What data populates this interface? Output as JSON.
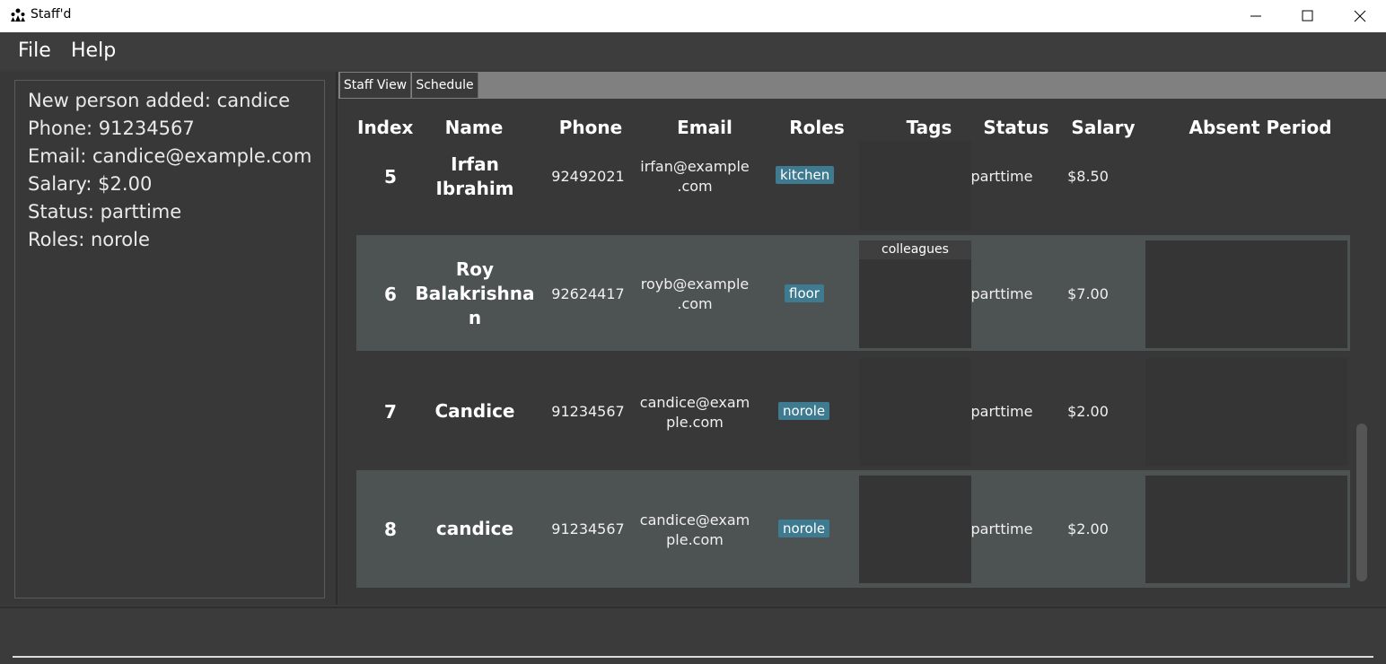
{
  "window": {
    "title": "Staff'd"
  },
  "menu": {
    "file": "File",
    "help": "Help"
  },
  "result": {
    "lines": [
      "New person added: candice",
      "Phone: 91234567",
      "Email: candice@example.com",
      "Salary: $2.00",
      "Status: parttime",
      "Roles: norole"
    ]
  },
  "tabs": {
    "staff_view": "Staff View",
    "schedule": "Schedule"
  },
  "table": {
    "headers": {
      "index": "Index",
      "name": "Name",
      "phone": "Phone",
      "email": "Email",
      "roles": "Roles",
      "tags": "Tags",
      "status": "Status",
      "salary": "Salary",
      "absent": "Absent Period"
    },
    "rows": [
      {
        "index": "5",
        "name_lines": [
          "Irfan",
          "Ibrahim"
        ],
        "phone": "92492021",
        "email_lines": [
          "irfan@example",
          ".com"
        ],
        "role": "kitchen",
        "tags": [],
        "status": "parttime",
        "salary": "$8.50"
      },
      {
        "index": "6",
        "name_lines": [
          "Roy",
          "Balakrishna",
          "n"
        ],
        "phone": "92624417",
        "email_lines": [
          "royb@example",
          ".com"
        ],
        "role": "floor",
        "tags": [
          "colleagues"
        ],
        "status": "parttime",
        "salary": "$7.00"
      },
      {
        "index": "7",
        "name_lines": [
          "Candice"
        ],
        "phone": "91234567",
        "email_lines": [
          "candice@exam",
          "ple.com"
        ],
        "role": "norole",
        "tags": [],
        "status": "parttime",
        "salary": "$2.00"
      },
      {
        "index": "8",
        "name_lines": [
          "candice"
        ],
        "phone": "91234567",
        "email_lines": [
          "candice@exam",
          "ple.com"
        ],
        "role": "norole",
        "tags": [],
        "status": "parttime",
        "salary": "$2.00"
      }
    ]
  },
  "colors": {
    "row_dark": "#383838",
    "row_light": "#4d5253",
    "role_badge": "#3e7b91"
  }
}
